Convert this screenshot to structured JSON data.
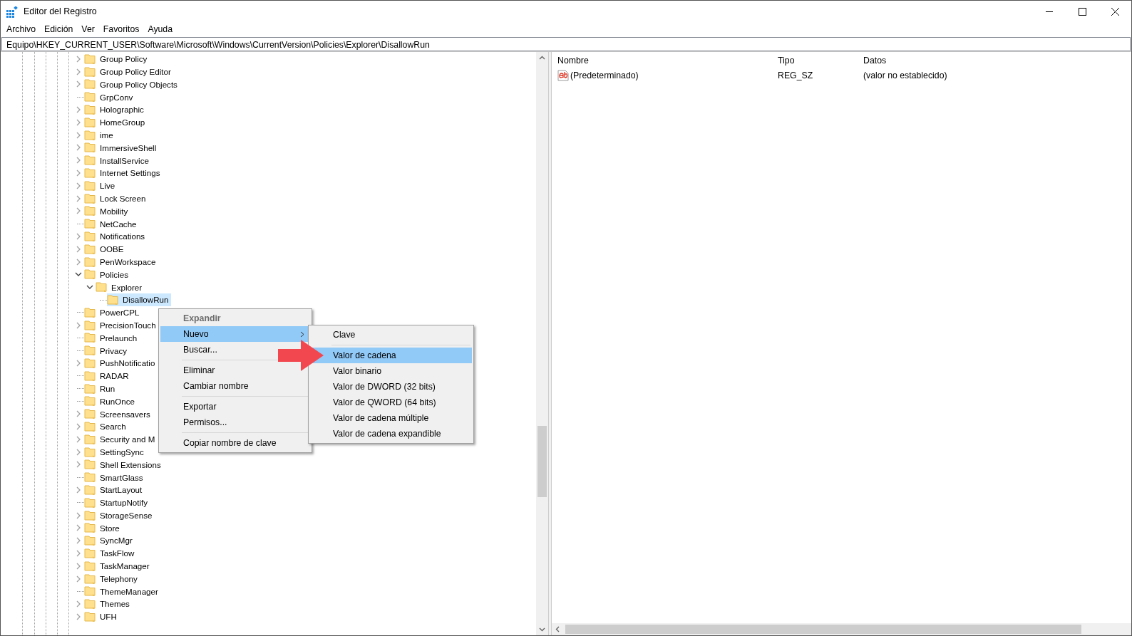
{
  "window": {
    "title": "Editor del Registro"
  },
  "menu": [
    "Archivo",
    "Edición",
    "Ver",
    "Favoritos",
    "Ayuda"
  ],
  "address": "Equipo\\HKEY_CURRENT_USER\\Software\\Microsoft\\Windows\\CurrentVersion\\Policies\\Explorer\\DisallowRun",
  "tree": [
    {
      "label": "Group Policy",
      "has_children": true,
      "expanded": false,
      "selected": false
    },
    {
      "label": "Group Policy Editor",
      "has_children": true,
      "expanded": false,
      "selected": false
    },
    {
      "label": "Group Policy Objects",
      "has_children": true,
      "expanded": false,
      "selected": false
    },
    {
      "label": "GrpConv",
      "has_children": false,
      "selected": false
    },
    {
      "label": "Holographic",
      "has_children": true,
      "expanded": false,
      "selected": false
    },
    {
      "label": "HomeGroup",
      "has_children": true,
      "expanded": false,
      "selected": false
    },
    {
      "label": "ime",
      "has_children": true,
      "expanded": false,
      "selected": false
    },
    {
      "label": "ImmersiveShell",
      "has_children": true,
      "expanded": false,
      "selected": false
    },
    {
      "label": "InstallService",
      "has_children": true,
      "expanded": false,
      "selected": false
    },
    {
      "label": "Internet Settings",
      "has_children": true,
      "expanded": false,
      "selected": false
    },
    {
      "label": "Live",
      "has_children": true,
      "expanded": false,
      "selected": false
    },
    {
      "label": "Lock Screen",
      "has_children": true,
      "expanded": false,
      "selected": false
    },
    {
      "label": "Mobility",
      "has_children": true,
      "expanded": false,
      "selected": false
    },
    {
      "label": "NetCache",
      "has_children": false,
      "selected": false
    },
    {
      "label": "Notifications",
      "has_children": true,
      "expanded": false,
      "selected": false
    },
    {
      "label": "OOBE",
      "has_children": true,
      "expanded": false,
      "selected": false
    },
    {
      "label": "PenWorkspace",
      "has_children": true,
      "expanded": false,
      "selected": false
    },
    {
      "label": "Policies",
      "has_children": true,
      "expanded": true,
      "selected": false,
      "children": [
        {
          "label": "Explorer",
          "has_children": true,
          "expanded": true,
          "selected": false,
          "children": [
            {
              "label": "DisallowRun",
              "has_children": false,
              "selected": true
            }
          ]
        }
      ]
    },
    {
      "label": "PowerCPL",
      "has_children": false,
      "selected": false
    },
    {
      "label": "PrecisionTouch",
      "has_children": true,
      "expanded": false,
      "selected": false
    },
    {
      "label": "Prelaunch",
      "has_children": false,
      "selected": false
    },
    {
      "label": "Privacy",
      "has_children": false,
      "selected": false
    },
    {
      "label": "PushNotificatio",
      "has_children": true,
      "expanded": false,
      "selected": false
    },
    {
      "label": "RADAR",
      "has_children": false,
      "selected": false
    },
    {
      "label": "Run",
      "has_children": false,
      "selected": false
    },
    {
      "label": "RunOnce",
      "has_children": false,
      "selected": false
    },
    {
      "label": "Screensavers",
      "has_children": true,
      "expanded": false,
      "selected": false
    },
    {
      "label": "Search",
      "has_children": true,
      "expanded": false,
      "selected": false
    },
    {
      "label": "Security and M",
      "has_children": true,
      "expanded": false,
      "selected": false
    },
    {
      "label": "SettingSync",
      "has_children": true,
      "expanded": false,
      "selected": false
    },
    {
      "label": "Shell Extensions",
      "has_children": true,
      "expanded": false,
      "selected": false
    },
    {
      "label": "SmartGlass",
      "has_children": false,
      "selected": false
    },
    {
      "label": "StartLayout",
      "has_children": true,
      "expanded": false,
      "selected": false
    },
    {
      "label": "StartupNotify",
      "has_children": false,
      "selected": false
    },
    {
      "label": "StorageSense",
      "has_children": true,
      "expanded": false,
      "selected": false
    },
    {
      "label": "Store",
      "has_children": true,
      "expanded": false,
      "selected": false
    },
    {
      "label": "SyncMgr",
      "has_children": true,
      "expanded": false,
      "selected": false
    },
    {
      "label": "TaskFlow",
      "has_children": true,
      "expanded": false,
      "selected": false
    },
    {
      "label": "TaskManager",
      "has_children": true,
      "expanded": false,
      "selected": false
    },
    {
      "label": "Telephony",
      "has_children": true,
      "expanded": false,
      "selected": false
    },
    {
      "label": "ThemeManager",
      "has_children": false,
      "selected": false
    },
    {
      "label": "Themes",
      "has_children": true,
      "expanded": false,
      "selected": false
    },
    {
      "label": "UFH",
      "has_children": true,
      "expanded": false,
      "selected": false
    }
  ],
  "values": {
    "columns": [
      "Nombre",
      "Tipo",
      "Datos"
    ],
    "rows": [
      {
        "name": "(Predeterminado)",
        "type": "REG_SZ",
        "data": "(valor no establecido)"
      }
    ]
  },
  "context_menu": {
    "groups": [
      [
        {
          "label": "Expandir",
          "default": true,
          "disabled": true,
          "selected": false,
          "submenu": false
        },
        {
          "label": "Nuevo",
          "default": false,
          "disabled": false,
          "selected": true,
          "submenu": true
        },
        {
          "label": "Buscar...",
          "default": false,
          "disabled": false,
          "selected": false,
          "submenu": false
        }
      ],
      [
        {
          "label": "Eliminar",
          "default": false,
          "disabled": false,
          "selected": false,
          "submenu": false
        },
        {
          "label": "Cambiar nombre",
          "default": false,
          "disabled": false,
          "selected": false,
          "submenu": false
        }
      ],
      [
        {
          "label": "Exportar",
          "default": false,
          "disabled": false,
          "selected": false,
          "submenu": false
        },
        {
          "label": "Permisos...",
          "default": false,
          "disabled": false,
          "selected": false,
          "submenu": false
        }
      ],
      [
        {
          "label": "Copiar nombre de clave",
          "default": false,
          "disabled": false,
          "selected": false,
          "submenu": false
        }
      ]
    ]
  },
  "submenu": {
    "groups": [
      [
        {
          "label": "Clave",
          "selected": false
        }
      ],
      [
        {
          "label": "Valor de cadena",
          "selected": true
        },
        {
          "label": "Valor binario",
          "selected": false
        },
        {
          "label": "Valor de DWORD (32 bits)",
          "selected": false
        },
        {
          "label": "Valor de QWORD (64 bits)",
          "selected": false
        },
        {
          "label": "Valor de cadena múltiple",
          "selected": false
        },
        {
          "label": "Valor de cadena expandible",
          "selected": false
        }
      ]
    ]
  }
}
